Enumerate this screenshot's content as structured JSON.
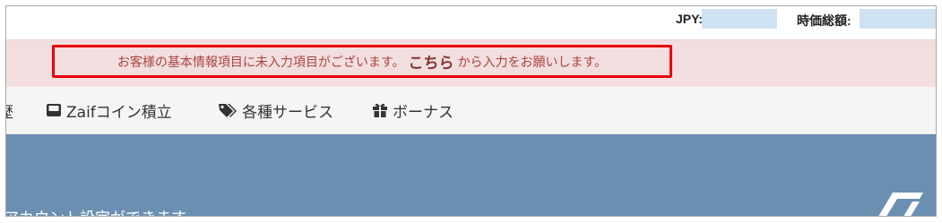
{
  "header": {
    "jpy_label": "JPY:",
    "total_label": "時価総額:"
  },
  "notice": {
    "text_before": "お客様の基本情報項目に未入力項目がございます。",
    "link_text": "こちら",
    "text_after": "から入力をお願いします。",
    "background": "#f2dede",
    "highlight_border": "#e8000b"
  },
  "nav": {
    "partial_prev": "歴",
    "items": [
      {
        "icon": "inbox-icon",
        "label": "Zaifコイン積立"
      },
      {
        "icon": "tags-icon",
        "label": "各種サービス"
      },
      {
        "icon": "gift-icon",
        "label": "ボーナス"
      }
    ]
  },
  "hero": {
    "text": "アカウント設定ができます",
    "background": "#6a8fb1"
  }
}
